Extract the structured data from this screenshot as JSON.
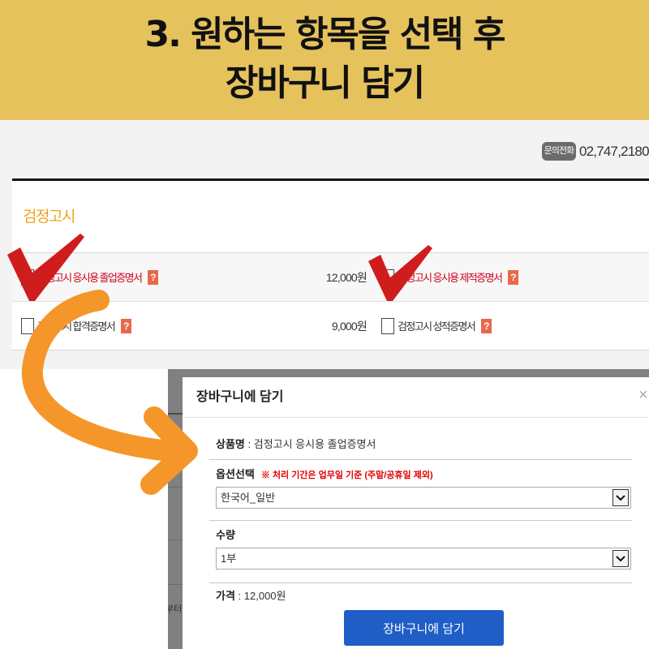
{
  "banner": {
    "line1": "3. 원하는 항목을 선택 후",
    "line2": "장바구니 담기"
  },
  "header": {
    "contact_badge": "문의전화",
    "contact_number": "02,747,2180 ("
  },
  "catalog": {
    "category_title": "검정고시",
    "help_glyph": "?",
    "help_icon": "help-icon",
    "rows": [
      {
        "left": {
          "name": "검정고시 응시용 졸업증명서",
          "price": "12,000원"
        },
        "right": {
          "name": "검정고시 응시용 제적증명서"
        }
      },
      {
        "left": {
          "name": "검정고시 합격증명서",
          "price": "9,000원"
        },
        "right": {
          "name": "검정고시 성적증명서"
        }
      }
    ]
  },
  "background_fragment": "부터",
  "modal": {
    "title": "장바구니에 담기",
    "close_glyph": "×",
    "close_icon": "close-icon",
    "separator": " : ",
    "product_label": "상품명",
    "product_value": "검정고시 응시용 졸업증명서",
    "option_label": "옵션선택",
    "option_note": "※ 처리 기간은 업무일 기준 (주말/공휴일 제외)",
    "option_value": "한국어_일반",
    "quantity_label": "수량",
    "quantity_value": "1부",
    "dropdown_icon": "chevron-down-icon",
    "price_label": "가격",
    "price_value": "12,000원",
    "submit_label": "장바구니에 담기"
  },
  "overlays": {
    "checkmark_icon": "red-checkmark-icon",
    "arrow_icon": "curved-arrow-icon"
  },
  "colors": {
    "banner_bg": "#e6c25d",
    "category_orange": "#f0a21f",
    "highlight_red": "#d0021b",
    "help_icon": "#e8684a",
    "note_red": "#e00000",
    "button_blue": "#1f5ec6",
    "arrow_orange": "#f5962a",
    "check_red": "#cf1d1d"
  }
}
